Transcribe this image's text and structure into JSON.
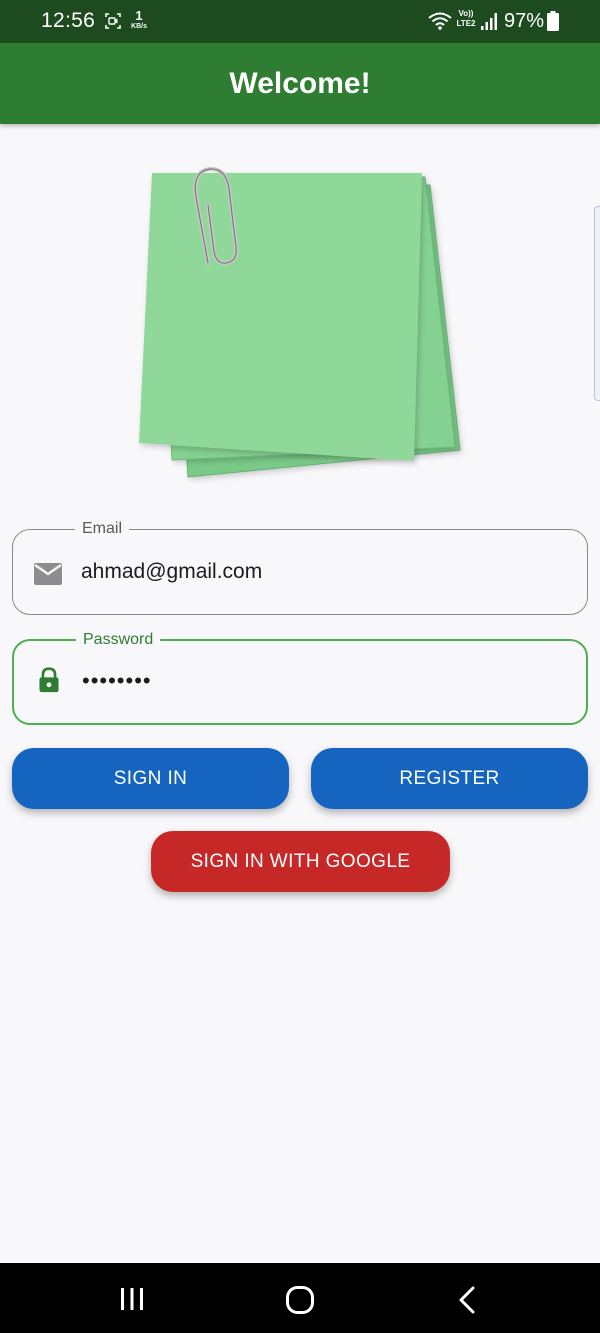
{
  "status_bar": {
    "time": "12:56",
    "net_speed_value": "1",
    "net_speed_unit": "KB/s",
    "volte_line1": "Vo))",
    "volte_line2": "LTE2",
    "battery_percent": "97%",
    "icons": [
      "screen-record-icon",
      "wifi-icon",
      "signal-icon",
      "battery-icon"
    ]
  },
  "app_bar": {
    "title": "Welcome!",
    "color": "#2e7d32"
  },
  "illustration": {
    "icon": "sticky-notes-with-paperclip",
    "note_color": "#8fd89a"
  },
  "form": {
    "email": {
      "label": "Email",
      "value": "ahmad@gmail.com",
      "icon": "mail-icon"
    },
    "password": {
      "label": "Password",
      "value": "••••••••",
      "icon": "lock-icon",
      "focused": true,
      "focus_color": "#4caf50"
    }
  },
  "buttons": {
    "sign_in": "SIGN IN",
    "register": "REGISTER",
    "sign_in_google": "SIGN IN WITH GOOGLE",
    "primary_color": "#1565c0",
    "google_color": "#c62828"
  },
  "nav_bar": {
    "icons": [
      "recents-icon",
      "home-icon",
      "back-icon"
    ]
  }
}
